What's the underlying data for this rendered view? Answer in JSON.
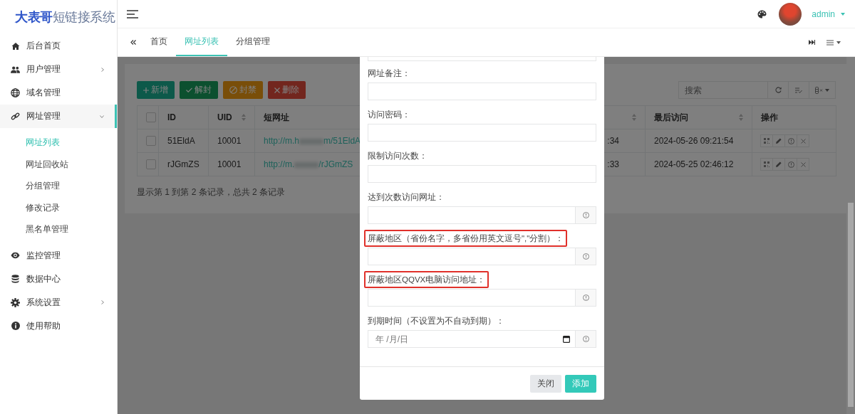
{
  "brand": {
    "strong": "大表哥",
    "rest": "短链接系统"
  },
  "header": {
    "user": "admin"
  },
  "sidebar": {
    "items": [
      {
        "label": "后台首页",
        "selected": false
      },
      {
        "label": "用户管理",
        "selected": false,
        "expanded": false
      },
      {
        "label": "域名管理",
        "selected": false
      },
      {
        "label": "网址管理",
        "selected": false,
        "expanded": true,
        "children": [
          {
            "label": "网址列表",
            "selected": true
          },
          {
            "label": "网址回收站",
            "selected": false
          },
          {
            "label": "分组管理",
            "selected": false
          },
          {
            "label": "修改记录",
            "selected": false
          },
          {
            "label": "黑名单管理",
            "selected": false
          }
        ]
      },
      {
        "label": "监控管理",
        "selected": false
      },
      {
        "label": "数据中心",
        "selected": false
      },
      {
        "label": "系统设置",
        "selected": false,
        "expanded": false
      },
      {
        "label": "使用帮助",
        "selected": false
      }
    ]
  },
  "tabs": [
    {
      "label": "首页",
      "selected": false
    },
    {
      "label": "网址列表",
      "selected": true
    },
    {
      "label": "分组管理",
      "selected": false
    }
  ],
  "toolbar": {
    "buttons": [
      {
        "kind": "add",
        "label": "新增"
      },
      {
        "kind": "unblock",
        "label": "解封"
      },
      {
        "kind": "block",
        "label": "封禁"
      },
      {
        "kind": "delete",
        "label": "删除"
      }
    ],
    "search": {
      "placeholder": "搜索"
    }
  },
  "table": {
    "columns": [
      {
        "kind": "checkbox",
        "checked": false
      },
      {
        "label": "ID",
        "sortable": false
      },
      {
        "label": "UID",
        "sortable": true
      },
      {
        "label": "短网址"
      },
      {
        "sortable": true
      },
      {
        "label": "最后访问",
        "sortable": true
      },
      {
        "label": "操作",
        "sortable": false
      }
    ],
    "rows": [
      {
        "checked": false,
        "id": "51EldA",
        "uid": "10001",
        "url_start": "http://m.h",
        "url_end": "m/51EldA",
        "column_5": ":34",
        "last_visit": "2024-05-26 09:21:54"
      },
      {
        "checked": false,
        "id": "rJGmZS",
        "uid": "10001",
        "url_start": "http://m.",
        "url_end": "/rJGmZS",
        "column_5": ":33",
        "last_visit": "2024-05-25 02:46:12"
      }
    ],
    "summary": "显示第 1 到第 2 条记录，总共 2 条记录"
  },
  "modal": {
    "fields": [
      {
        "kind": "cut"
      },
      {
        "kind": "text",
        "label": "网址备注：",
        "highlighted": false
      },
      {
        "kind": "text",
        "label": "访问密码：",
        "highlighted": false
      },
      {
        "kind": "text",
        "label": "限制访问次数：",
        "highlighted": false
      },
      {
        "kind": "addon",
        "label": "达到次数访问网址：",
        "highlighted": false
      },
      {
        "kind": "addon",
        "label": "屏蔽地区（省份名字，多省份用英文逗号\",\"分割）：",
        "highlighted": true
      },
      {
        "kind": "addon",
        "label": "屏蔽地区QQVX电脑访问地址：",
        "highlighted": true
      },
      {
        "kind": "date",
        "label": "到期时间（不设置为不自动到期）：",
        "placeholder": "年 /月/日",
        "highlighted": false
      }
    ],
    "buttons": [
      {
        "kind": "secondary",
        "label": "关闭"
      },
      {
        "kind": "primary",
        "label": "添加"
      }
    ]
  }
}
